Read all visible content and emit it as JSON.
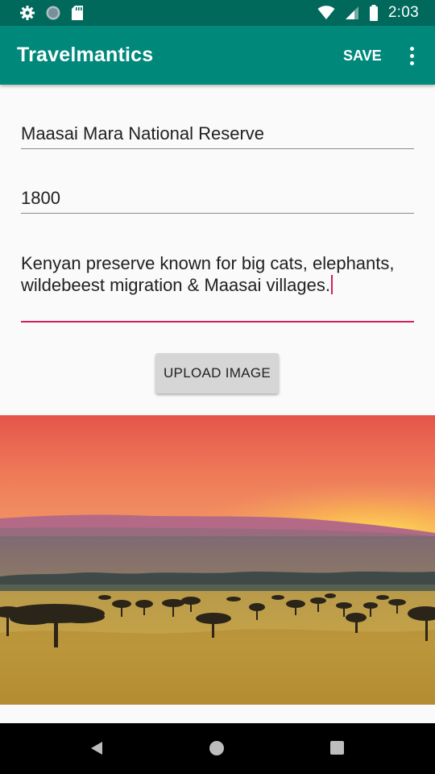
{
  "status_bar": {
    "time": "2:03",
    "icons_left": [
      "gear-icon",
      "circle-icon",
      "sd-card-icon"
    ],
    "icons_right": [
      "wifi-icon",
      "signal-icon",
      "battery-icon"
    ]
  },
  "app_bar": {
    "title": "Travelmantics",
    "save_label": "SAVE",
    "overflow_icon": "more-vert-icon"
  },
  "form": {
    "title_value": "Maasai Mara National Reserve",
    "price_value": "1800",
    "description_value": "Kenyan preserve known for big cats, elephants, wildebeest migration & Maasai villages.",
    "upload_label": "UPLOAD IMAGE"
  },
  "nav_bar": {
    "icons": [
      "back-icon",
      "home-icon",
      "recents-icon"
    ]
  },
  "colors": {
    "status_bar": "#00695c",
    "app_bar": "#00897b",
    "accent": "#d81b60",
    "background": "#fafafa"
  }
}
